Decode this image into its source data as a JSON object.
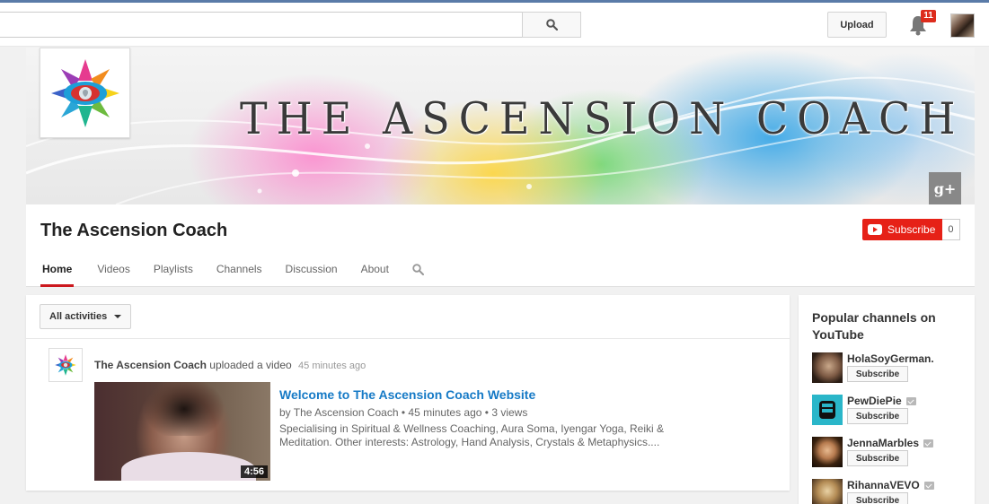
{
  "masthead": {
    "search_placeholder": "",
    "upload_label": "Upload",
    "notification_count": "11"
  },
  "channel": {
    "banner_text": "THE ASCENSION COACH",
    "gplus_label": "g+",
    "title": "The Ascension Coach",
    "subscribe_label": "Subscribe",
    "subscriber_count": "0",
    "tabs": [
      {
        "label": "Home",
        "active": true
      },
      {
        "label": "Videos"
      },
      {
        "label": "Playlists"
      },
      {
        "label": "Channels"
      },
      {
        "label": "Discussion"
      },
      {
        "label": "About"
      }
    ]
  },
  "feed": {
    "filter_label": "All activities",
    "activity": {
      "author": "The Ascension Coach",
      "action": "uploaded a video",
      "time": "45 minutes ago",
      "video": {
        "title": "Welcome to The Ascension Coach Website",
        "meta": "by The Ascension Coach • 45 minutes ago • 3 views",
        "description": "Specialising in Spiritual & Wellness Coaching, Aura Soma, Iyengar Yoga, Reiki & Meditation. Other interests: Astrology, Hand Analysis, Crystals & Metaphysics....",
        "duration": "4:56"
      }
    }
  },
  "sidebar": {
    "title": "Popular channels on YouTube",
    "channels": [
      {
        "name": "HolaSoyGerman.",
        "subscribe": "Subscribe",
        "verified": false
      },
      {
        "name": "PewDiePie",
        "subscribe": "Subscribe",
        "verified": true
      },
      {
        "name": "JennaMarbles",
        "subscribe": "Subscribe",
        "verified": true
      },
      {
        "name": "RihannaVEVO",
        "subscribe": "Subscribe",
        "verified": true
      }
    ]
  },
  "colors": {
    "brand_red": "#e62117",
    "link_blue": "#167ac6",
    "tab_underline": "#cc181e"
  }
}
